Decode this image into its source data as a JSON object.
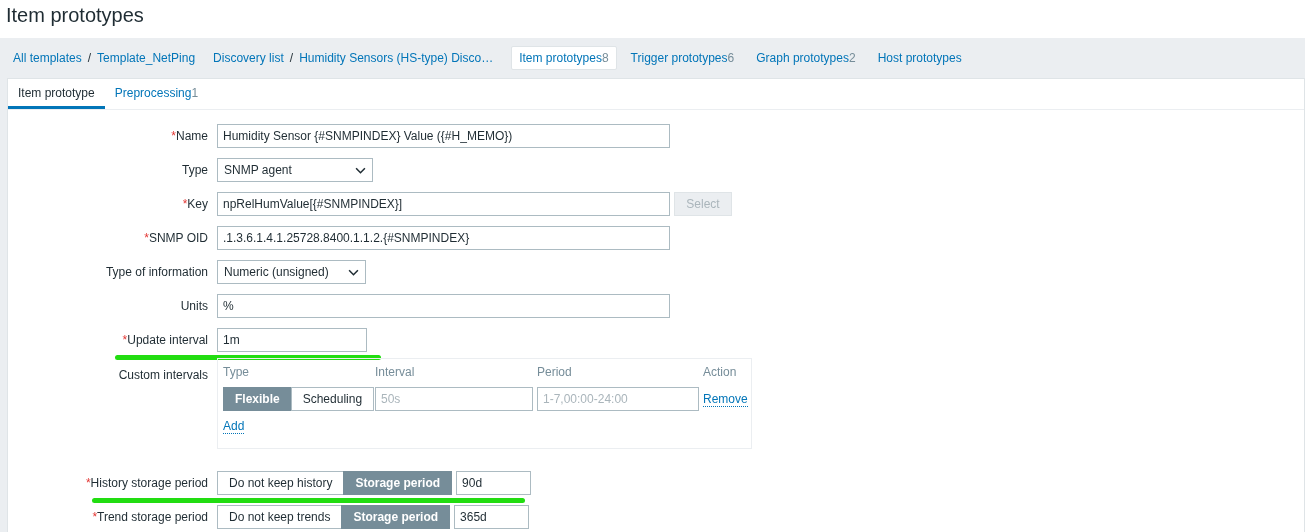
{
  "page_title": "Item prototypes",
  "required_mark": "*",
  "breadcrumbs": {
    "separator": "/",
    "groups": [
      [
        "All templates",
        "Template_NetPing"
      ],
      [
        "Discovery list",
        "Humidity Sensors (HS-type) Disco…"
      ]
    ]
  },
  "nav_tabs": [
    {
      "label": "Item prototypes",
      "count": "8",
      "selected": true
    },
    {
      "label": "Trigger prototypes",
      "count": "6",
      "selected": false
    },
    {
      "label": "Graph prototypes",
      "count": "2",
      "selected": false
    },
    {
      "label": "Host prototypes",
      "selected": false
    }
  ],
  "form_tabs": [
    {
      "label": "Item prototype",
      "selected": true
    },
    {
      "label": "Preprocessing",
      "count": "1",
      "selected": false
    }
  ],
  "rows": [
    {
      "kind": "text",
      "label": "Name",
      "required": true,
      "value": "Humidity Sensor {#SNMPINDEX} Value ({#H_MEMO})"
    },
    {
      "kind": "select",
      "label": "Type",
      "required": false,
      "value": "SNMP agent"
    },
    {
      "kind": "text_button",
      "label": "Key",
      "required": true,
      "value": "npRelHumValue[{#SNMPINDEX}]",
      "button": {
        "label": "Select",
        "disabled": true
      }
    },
    {
      "kind": "text",
      "label": "SNMP OID",
      "required": true,
      "value": ".1.3.6.1.4.1.25728.8400.1.1.2.{#SNMPINDEX}"
    },
    {
      "kind": "select",
      "label": "Type of information",
      "required": false,
      "value": "Numeric (unsigned)"
    },
    {
      "kind": "text",
      "label": "Units",
      "required": false,
      "value": "%"
    },
    {
      "kind": "text",
      "label": "Update interval",
      "required": true,
      "value": "1m",
      "highlighted": true
    },
    {
      "kind": "intervals",
      "label": "Custom intervals",
      "required": false,
      "columns": [
        "Type",
        "Interval",
        "Period",
        "Action"
      ],
      "entries": [
        {
          "types": [
            {
              "label": "Flexible",
              "selected": true
            },
            {
              "label": "Scheduling",
              "selected": false
            }
          ],
          "interval_placeholder": "50s",
          "period_placeholder": "1-7,00:00-24:00",
          "action": "Remove"
        }
      ],
      "add": "Add"
    },
    {
      "kind": "storage",
      "label": "History storage period",
      "required": true,
      "options": [
        {
          "label": "Do not keep history",
          "selected": false
        },
        {
          "label": "Storage period",
          "selected": true
        }
      ],
      "value": "90d",
      "highlighted": true
    },
    {
      "kind": "storage",
      "label": "Trend storage period",
      "required": true,
      "options": [
        {
          "label": "Do not keep trends",
          "selected": false
        },
        {
          "label": "Storage period",
          "selected": true
        }
      ],
      "value": "365d",
      "highlighted": false
    }
  ]
}
